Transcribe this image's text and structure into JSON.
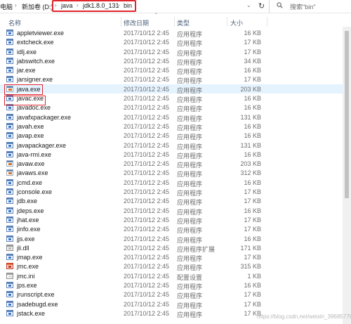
{
  "address": {
    "root": "电脑",
    "drive": "新加卷 (D:)",
    "segments": [
      "java",
      "jdk1.8.0_131",
      "bin"
    ]
  },
  "search": {
    "placeholder": "搜索\"bin\""
  },
  "columns": {
    "name": "名称",
    "date": "修改日期",
    "type": "类型",
    "size": "大小"
  },
  "files": [
    {
      "name": "appletviewer.exe",
      "date": "2017/10/12 2:45",
      "type": "应用程序",
      "size": "16 KB",
      "icon": "exe"
    },
    {
      "name": "extcheck.exe",
      "date": "2017/10/12 2:45",
      "type": "应用程序",
      "size": "17 KB",
      "icon": "exe"
    },
    {
      "name": "idlj.exe",
      "date": "2017/10/12 2:45",
      "type": "应用程序",
      "size": "17 KB",
      "icon": "exe"
    },
    {
      "name": "jabswitch.exe",
      "date": "2017/10/12 2:45",
      "type": "应用程序",
      "size": "34 KB",
      "icon": "exe"
    },
    {
      "name": "jar.exe",
      "date": "2017/10/12 2:45",
      "type": "应用程序",
      "size": "16 KB",
      "icon": "exe"
    },
    {
      "name": "jarsigner.exe",
      "date": "2017/10/12 2:45",
      "type": "应用程序",
      "size": "17 KB",
      "icon": "exe"
    },
    {
      "name": "java.exe",
      "date": "2017/10/12 2:45",
      "type": "应用程序",
      "size": "203 KB",
      "icon": "java"
    },
    {
      "name": "javac.exe",
      "date": "2017/10/12 2:45",
      "type": "应用程序",
      "size": "16 KB",
      "icon": "exe"
    },
    {
      "name": "javadoc.exe",
      "date": "2017/10/12 2:45",
      "type": "应用程序",
      "size": "16 KB",
      "icon": "exe"
    },
    {
      "name": "javafxpackager.exe",
      "date": "2017/10/12 2:45",
      "type": "应用程序",
      "size": "131 KB",
      "icon": "exe"
    },
    {
      "name": "javah.exe",
      "date": "2017/10/12 2:45",
      "type": "应用程序",
      "size": "16 KB",
      "icon": "exe"
    },
    {
      "name": "javap.exe",
      "date": "2017/10/12 2:45",
      "type": "应用程序",
      "size": "16 KB",
      "icon": "exe"
    },
    {
      "name": "javapackager.exe",
      "date": "2017/10/12 2:45",
      "type": "应用程序",
      "size": "131 KB",
      "icon": "exe"
    },
    {
      "name": "java-rmi.exe",
      "date": "2017/10/12 2:45",
      "type": "应用程序",
      "size": "16 KB",
      "icon": "exe"
    },
    {
      "name": "javaw.exe",
      "date": "2017/10/12 2:45",
      "type": "应用程序",
      "size": "203 KB",
      "icon": "java"
    },
    {
      "name": "javaws.exe",
      "date": "2017/10/12 2:45",
      "type": "应用程序",
      "size": "312 KB",
      "icon": "java"
    },
    {
      "name": "jcmd.exe",
      "date": "2017/10/12 2:45",
      "type": "应用程序",
      "size": "16 KB",
      "icon": "exe"
    },
    {
      "name": "jconsole.exe",
      "date": "2017/10/12 2:45",
      "type": "应用程序",
      "size": "17 KB",
      "icon": "exe"
    },
    {
      "name": "jdb.exe",
      "date": "2017/10/12 2:45",
      "type": "应用程序",
      "size": "17 KB",
      "icon": "exe"
    },
    {
      "name": "jdeps.exe",
      "date": "2017/10/12 2:45",
      "type": "应用程序",
      "size": "16 KB",
      "icon": "exe"
    },
    {
      "name": "jhat.exe",
      "date": "2017/10/12 2:45",
      "type": "应用程序",
      "size": "17 KB",
      "icon": "exe"
    },
    {
      "name": "jinfo.exe",
      "date": "2017/10/12 2:45",
      "type": "应用程序",
      "size": "17 KB",
      "icon": "exe"
    },
    {
      "name": "jjs.exe",
      "date": "2017/10/12 2:45",
      "type": "应用程序",
      "size": "16 KB",
      "icon": "exe"
    },
    {
      "name": "jli.dll",
      "date": "2017/10/12 2:45",
      "type": "应用程序扩展",
      "size": "171 KB",
      "icon": "dll"
    },
    {
      "name": "jmap.exe",
      "date": "2017/10/12 2:45",
      "type": "应用程序",
      "size": "17 KB",
      "icon": "exe"
    },
    {
      "name": "jmc.exe",
      "date": "2017/10/12 2:45",
      "type": "应用程序",
      "size": "315 KB",
      "icon": "jmc"
    },
    {
      "name": "jmc.ini",
      "date": "2017/10/12 2:45",
      "type": "配置设置",
      "size": "1 KB",
      "icon": "ini"
    },
    {
      "name": "jps.exe",
      "date": "2017/10/12 2:45",
      "type": "应用程序",
      "size": "16 KB",
      "icon": "exe"
    },
    {
      "name": "jrunscript.exe",
      "date": "2017/10/12 2:45",
      "type": "应用程序",
      "size": "17 KB",
      "icon": "exe"
    },
    {
      "name": "jsadebugd.exe",
      "date": "2017/10/12 2:45",
      "type": "应用程序",
      "size": "17 KB",
      "icon": "exe"
    },
    {
      "name": "jstack.exe",
      "date": "2017/10/12 2:45",
      "type": "应用程序",
      "size": "17 KB",
      "icon": "exe"
    }
  ],
  "highlighted": [
    "java.exe"
  ],
  "annotated": [
    "java.exe",
    "javac.exe"
  ],
  "watermark": "https://blog.csdn.net/weixin_39685776",
  "colors": {
    "annotation": "#e0252b",
    "selection": "#e5f3ff",
    "header_text": "#4c607a"
  }
}
